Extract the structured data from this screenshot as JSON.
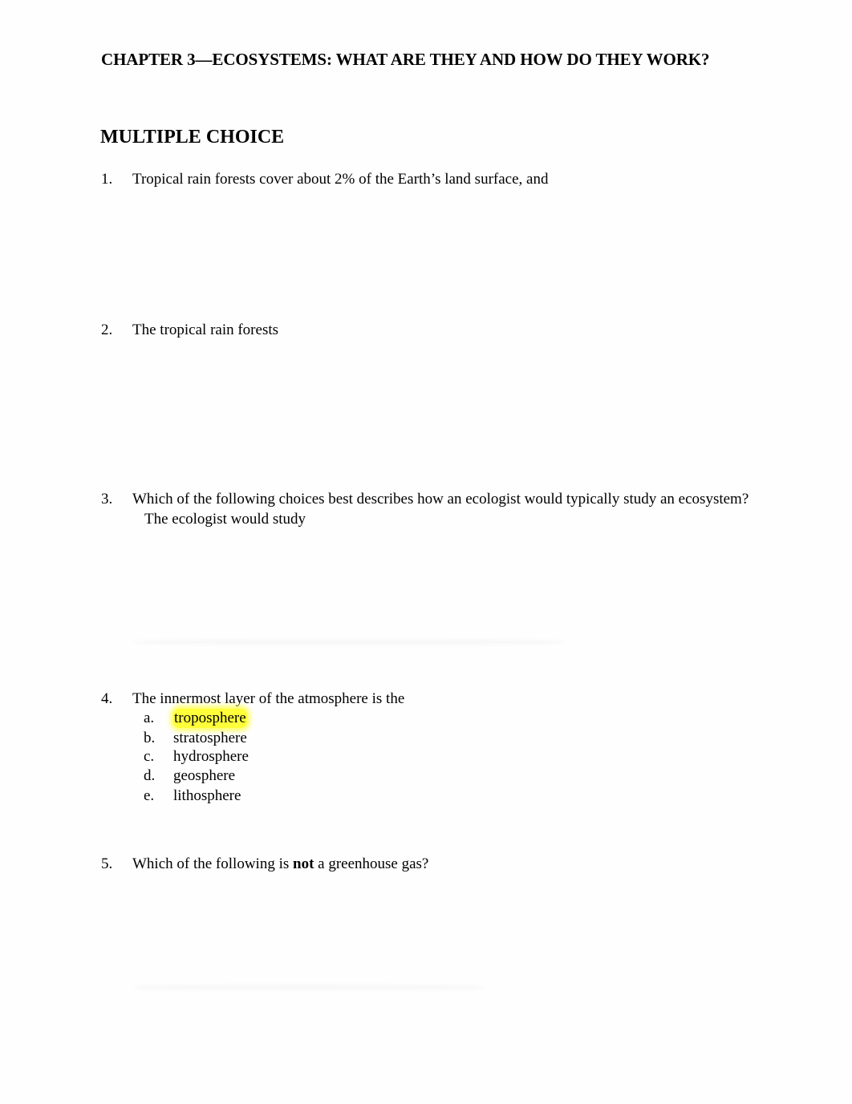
{
  "document": {
    "chapter_title": "CHAPTER 3—ECOSYSTEMS: WHAT ARE THEY AND HOW DO THEY WORK?",
    "section_heading": "MULTIPLE CHOICE",
    "questions": [
      {
        "number": "1.",
        "text": "Tropical rain forests cover about 2% of the Earth’s land surface, and"
      },
      {
        "number": "2.",
        "text": "The tropical rain forests"
      },
      {
        "number": "3.",
        "text": "Which of the following choices best describes how an ecologist would typically study an ecosystem?",
        "text_continued": "The ecologist would study"
      },
      {
        "number": "4.",
        "text": "The innermost layer of the atmosphere is the",
        "options": [
          {
            "letter": "a.",
            "text": "troposphere",
            "highlighted": true
          },
          {
            "letter": "b.",
            "text": "stratosphere"
          },
          {
            "letter": "c.",
            "text": "hydrosphere"
          },
          {
            "letter": "d.",
            "text": "geosphere"
          },
          {
            "letter": "e.",
            "text": "lithosphere"
          }
        ]
      },
      {
        "number": "5.",
        "text_before": "Which of the following is ",
        "text_bold": "not",
        "text_after": " a greenhouse gas?"
      }
    ]
  },
  "colors": {
    "highlight": "#ffff3a",
    "text": "#000000",
    "background": "#fefefe"
  }
}
